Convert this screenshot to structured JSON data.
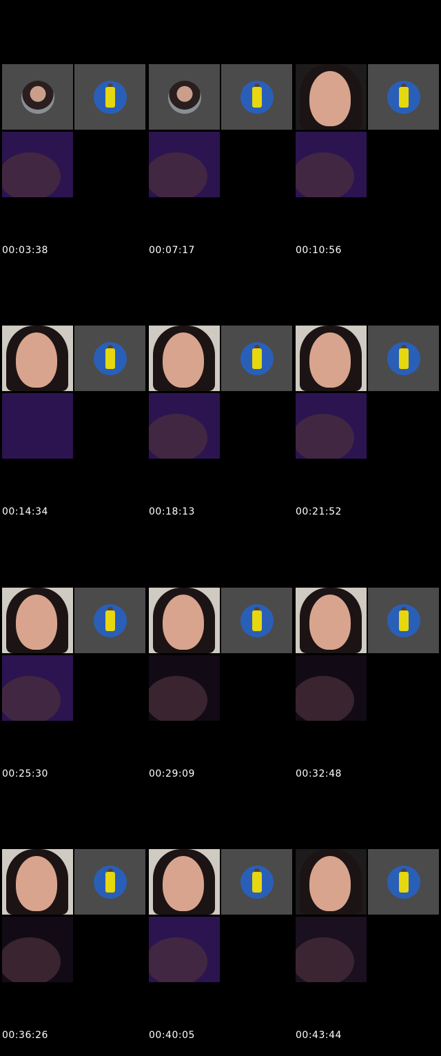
{
  "timestamps": [
    "00:03:38",
    "00:07:17",
    "00:10:56",
    "00:14:34",
    "00:18:13",
    "00:21:52",
    "00:25:30",
    "00:29:09",
    "00:32:48",
    "00:36:26",
    "00:40:05",
    "00:43:44"
  ],
  "icons": {
    "profile_woman": "avatar-woman-icon",
    "profile_man": "avatar-man-icon"
  },
  "colors": {
    "background": "#000000",
    "tile_gray": "#4b4b4b",
    "avatar_blue": "#2a5fb8",
    "shirt_yellow": "#e6d70f",
    "purple_room": "#2c1450"
  }
}
